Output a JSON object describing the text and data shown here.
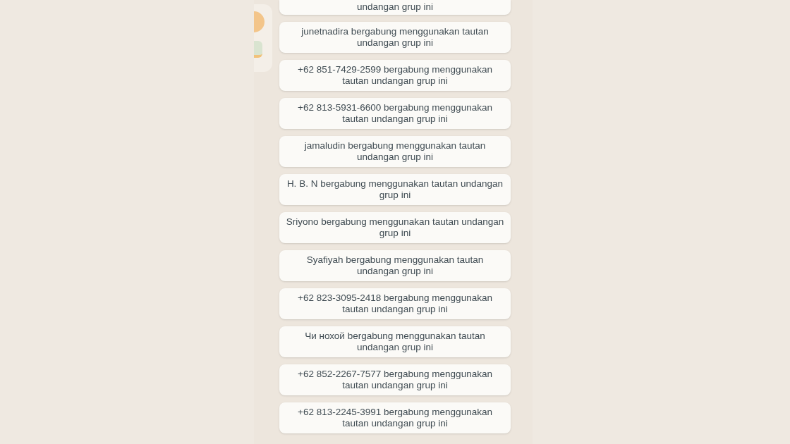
{
  "messages": [
    {
      "text": "undangan grup ini"
    },
    {
      "text": "junetnadira bergabung menggunakan tautan undangan grup ini"
    },
    {
      "text": "+62 851-7429-2599 bergabung menggunakan tautan undangan grup ini"
    },
    {
      "text": "+62 813-5931-6600 bergabung menggunakan tautan undangan grup ini"
    },
    {
      "text": "jamaludin bergabung menggunakan tautan undangan grup ini"
    },
    {
      "text": "H. B. N bergabung menggunakan tautan undangan grup ini"
    },
    {
      "text": "Sriyono bergabung menggunakan tautan undangan grup ini"
    },
    {
      "text": "Syafiyah bergabung menggunakan tautan undangan grup ini"
    },
    {
      "text": "+62 823-3095-2418 bergabung menggunakan tautan undangan grup ini"
    },
    {
      "text": "Чи нохой bergabung menggunakan tautan undangan grup ini"
    },
    {
      "text": "+62 852-2267-7577 bergabung menggunakan tautan undangan grup ini"
    },
    {
      "text": "+62 813-2245-3991 bergabung menggunakan tautan undangan grup ini"
    }
  ]
}
